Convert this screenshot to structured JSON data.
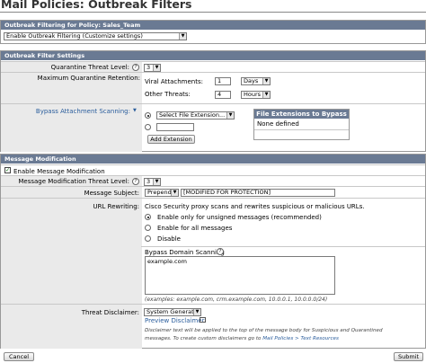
{
  "page": {
    "title": "Mail Policies: Outbreak Filters"
  },
  "policy": {
    "header": "Outbreak Filtering for Policy: Sales_Team",
    "mode_select": "Enable Outbreak Filtering (Customize settings)"
  },
  "filter_settings": {
    "header": "Outbreak Filter Settings",
    "quarantine_level_label": "Quarantine Threat Level:",
    "quarantine_level_value": "3",
    "max_retention_label": "Maximum Quarantine Retention:",
    "viral_label": "Viral Attachments:",
    "viral_value": "1",
    "viral_unit": "Days",
    "other_label": "Other Threats:",
    "other_value": "4",
    "other_unit": "Hours",
    "bypass_label": "Bypass Attachment Scanning:",
    "bypass_arrow": "▼",
    "file_ext_select": "Select File Extension...",
    "add_extension_button": "Add Extension",
    "ext_table_header": "File Extensions to Bypass",
    "ext_table_empty": "None defined"
  },
  "message_modification": {
    "header": "Message Modification",
    "enable_label": "Enable Message Modification",
    "threat_level_label": "Message Modification Threat Level:",
    "threat_level_value": "3",
    "subject_label": "Message Subject:",
    "subject_position": "Prepend",
    "subject_text": "[MODIFIED FOR PROTECTION]",
    "url_label": "URL Rewriting:",
    "url_description": "Cisco Security proxy scans and rewrites suspicious or malicious URLs.",
    "url_options": [
      "Enable only for unsigned messages (recommended)",
      "Enable for all messages",
      "Disable"
    ],
    "bypass_domain_label": "Bypass Domain Scanning",
    "bypass_domain_value": "example.com",
    "bypass_domain_hint": "(examples: example.com, crm.example.com, 10.0.0.1, 10.0.0.0/24)",
    "disclaimer_label": "Threat Disclaimer:",
    "disclaimer_value": "System Generated",
    "preview_link": "Preview Disclaimer",
    "disclaimer_note_1": "Disclaimer text will be applied to the top of the message body for Suspicious and Quarantined",
    "disclaimer_note_2": "messages. To create custom disclaimers go to",
    "disclaimer_link": "Mail Policies > Text Resources"
  },
  "footer": {
    "cancel": "Cancel",
    "submit": "Submit"
  },
  "icons": {
    "help": "help-icon",
    "dropdown": "chevron-down-icon",
    "popup": "popup-window-icon"
  }
}
